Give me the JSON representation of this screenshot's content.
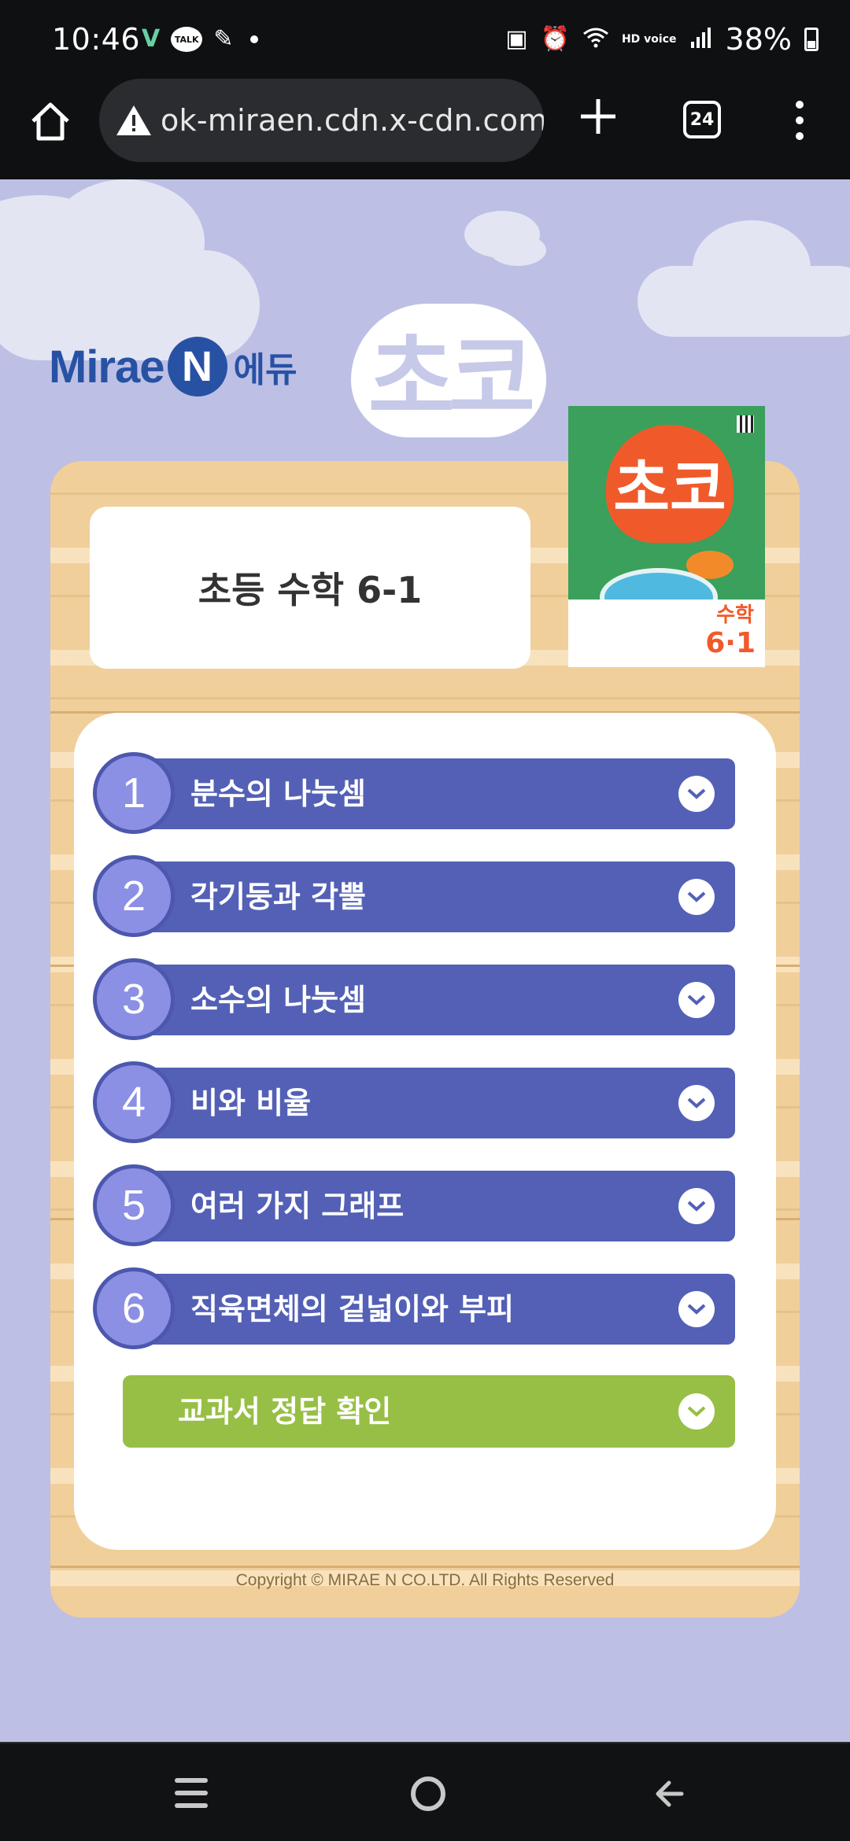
{
  "status_bar": {
    "time": "10:46",
    "talk_badge": "TALK",
    "network_label": "HD voice",
    "battery_percent": "38%"
  },
  "browser": {
    "url": "ok-miraen.cdn.x-cdn.com",
    "tab_count": "24"
  },
  "branding": {
    "publisher_text": "Mirae",
    "publisher_letter": "N",
    "publisher_suffix": "에듀",
    "series_logo": "초코"
  },
  "book": {
    "title": "초등 수학 6-1",
    "cover_series": "초코",
    "cover_subject": "수학",
    "cover_grade": "6·1"
  },
  "chapters": [
    {
      "number": "1",
      "title": "분수의 나눗셈"
    },
    {
      "number": "2",
      "title": "각기둥과 각뿔"
    },
    {
      "number": "3",
      "title": "소수의 나눗셈"
    },
    {
      "number": "4",
      "title": "비와 비율"
    },
    {
      "number": "5",
      "title": "여러 가지 그래프"
    },
    {
      "number": "6",
      "title": "직육면체의 겉넓이와 부피"
    }
  ],
  "answer_check": {
    "label": "교과서 정답 확인"
  },
  "footer": {
    "copyright": "Copyright © MIRAE N CO.LTD. All Rights Reserved"
  },
  "colors": {
    "page_bg": "#bdc0e4",
    "chapter_bar": "#5360b6",
    "chapter_circle": "#8b90e4",
    "answer_button": "#97bf45",
    "board": "#f0cf9a",
    "brand_blue": "#2752a4"
  }
}
